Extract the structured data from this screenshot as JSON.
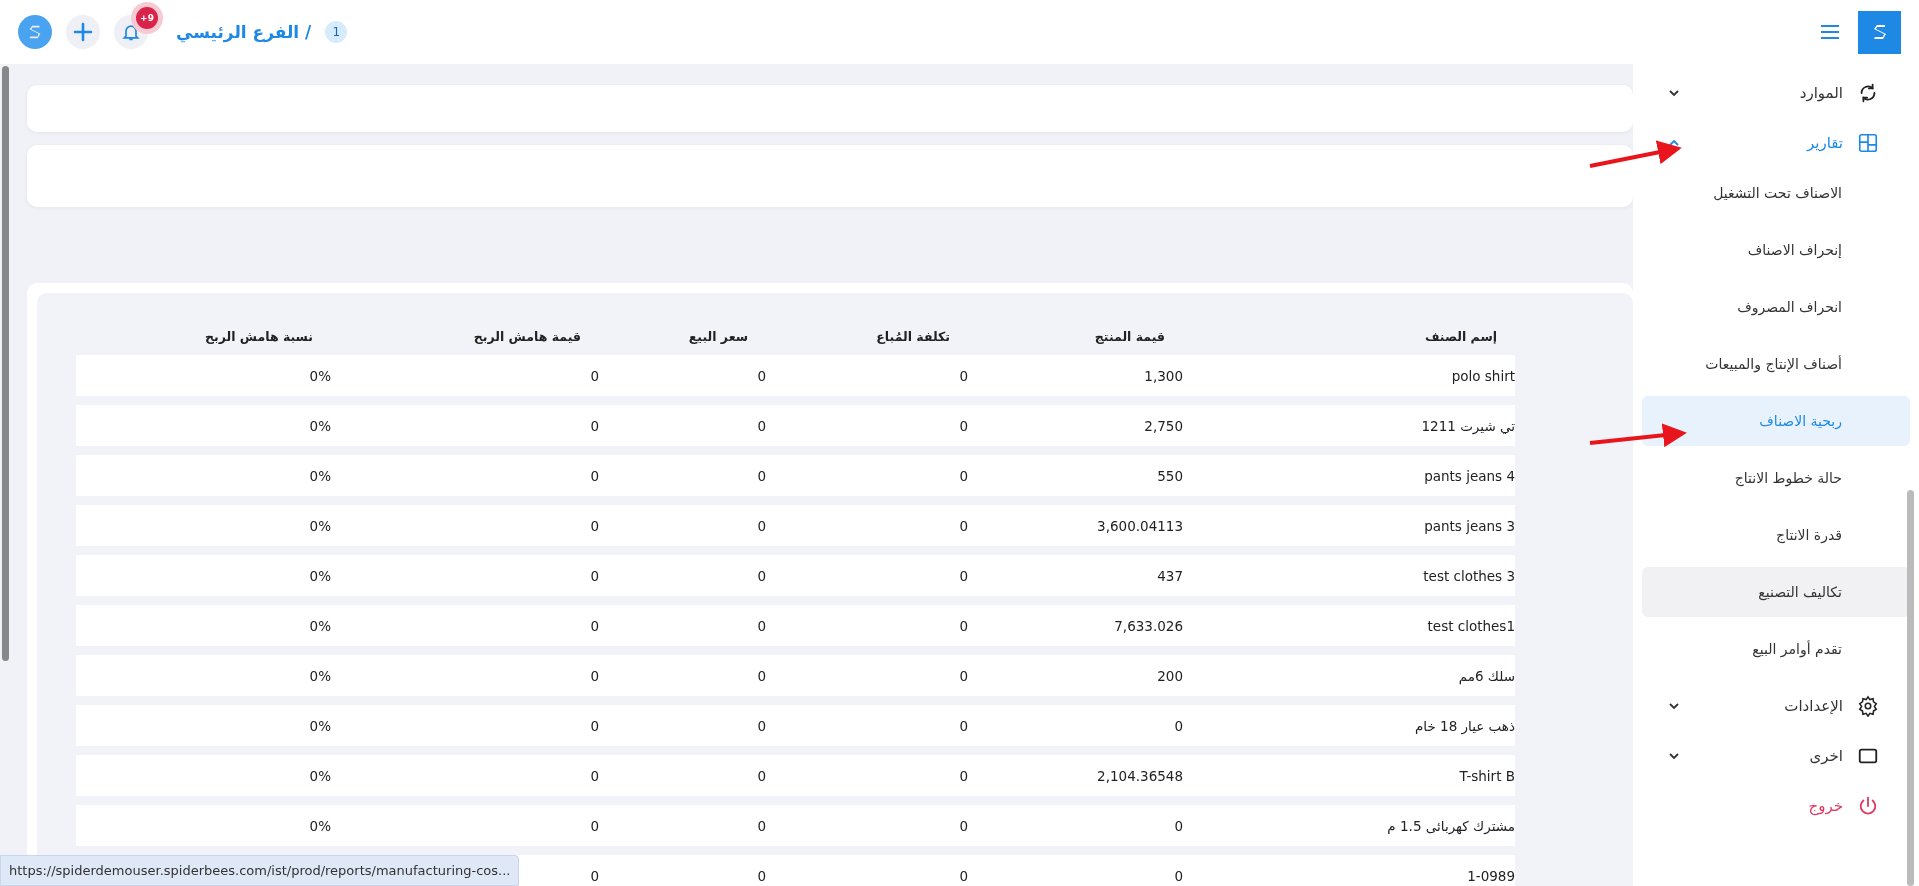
{
  "header": {
    "branch_number": "1",
    "breadcrumb": "الفرع الرئيسي /",
    "notification_badge": "+9"
  },
  "sidebar": {
    "items": [
      {
        "kind": "group",
        "label": "الموارد",
        "expanded": false
      },
      {
        "kind": "group",
        "label": "تقارير",
        "expanded": true,
        "children": [
          {
            "label": "الاصناف تحت التشغيل",
            "selected": false,
            "hovered": false
          },
          {
            "label": "إنحراف الاصناف",
            "selected": false,
            "hovered": false
          },
          {
            "label": "انحراف المصروف",
            "selected": false,
            "hovered": false
          },
          {
            "label": "أصناف الإنتاج والمبيعات",
            "selected": false,
            "hovered": false
          },
          {
            "label": "ربحية الاصناف",
            "selected": true,
            "hovered": false
          },
          {
            "label": "حالة خطوط الانتاج",
            "selected": false,
            "hovered": false
          },
          {
            "label": "قدرة الانتاج",
            "selected": false,
            "hovered": false
          },
          {
            "label": "تكاليف التصنيع",
            "selected": false,
            "hovered": true
          },
          {
            "label": "تقدم أوامر البيع",
            "selected": false,
            "hovered": false
          }
        ]
      },
      {
        "kind": "group",
        "label": "الإعدادات",
        "expanded": false
      },
      {
        "kind": "group",
        "label": "اخرى",
        "expanded": false
      },
      {
        "kind": "logout",
        "label": "خروج"
      }
    ]
  },
  "table": {
    "columns": [
      "إسم الصنف",
      "قيمة المنتج",
      "تكلفة المُباع",
      "سعر البيع",
      "قيمة هامش الربح",
      "نسبة هامش الربح"
    ],
    "rows": [
      [
        "polo shirt",
        "1,300",
        "0",
        "0",
        "0",
        "0%"
      ],
      [
        "تي شيرت 1211",
        "2,750",
        "0",
        "0",
        "0",
        "0%"
      ],
      [
        "pants jeans  4",
        "550",
        "0",
        "0",
        "0",
        "0%"
      ],
      [
        "pants jeans  3",
        "3,600.04113",
        "0",
        "0",
        "0",
        "0%"
      ],
      [
        "test clothes 3",
        "437",
        "0",
        "0",
        "0",
        "0%"
      ],
      [
        "test clothes1",
        "7,633.026",
        "0",
        "0",
        "0",
        "0%"
      ],
      [
        "سلك 6مم",
        "200",
        "0",
        "0",
        "0",
        "0%"
      ],
      [
        "ذهب عيار 18 خام",
        "0",
        "0",
        "0",
        "0",
        "0%"
      ],
      [
        "T-shirt B",
        "2,104.36548",
        "0",
        "0",
        "0",
        "0%"
      ],
      [
        "مشترك كهربائى 1.5 م",
        "0",
        "0",
        "0",
        "0",
        "0%"
      ],
      [
        "1-0989",
        "0",
        "0",
        "0",
        "0"
      ]
    ]
  },
  "status_url": "https://spiderdemouser.spiderbees.com/ist/prod/reports/manufacturing-cos..."
}
